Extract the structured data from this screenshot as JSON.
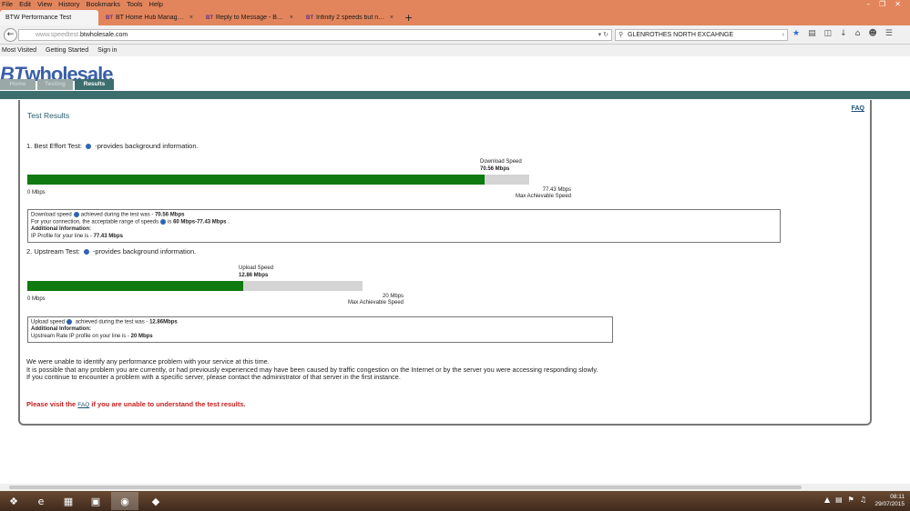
{
  "menu": [
    "File",
    "Edit",
    "View",
    "History",
    "Bookmarks",
    "Tools",
    "Help"
  ],
  "window_controls": [
    "–",
    "❐",
    "✕"
  ],
  "tabs": [
    {
      "label": "BTW Performance Test",
      "active": true
    },
    {
      "label": "BT Home Hub Manager - I...",
      "active": false
    },
    {
      "label": "Reply to Message - BTCare...",
      "active": false
    },
    {
      "label": "Infinity 2 speeds but not d...",
      "active": false
    }
  ],
  "tab_icon_text": "BT",
  "tab_close": "×",
  "new_tab": "+",
  "address": {
    "prefix": "www.speedtest.",
    "domain": "btwholesale.com"
  },
  "search": {
    "value": "GLENROTHES NORTH EXCAHNGE"
  },
  "bookmarks": [
    "Most Visited",
    "Getting Started",
    "Sign in"
  ],
  "site": {
    "logo_bt": "BT",
    "logo_rest": "wholesale",
    "nav_tabs": [
      "Home",
      "Testing",
      "Results"
    ],
    "active_tab": "Results"
  },
  "results": {
    "title": "Test Results",
    "faq": "FAQ",
    "download": {
      "heading": "1. Best Effort Test:",
      "heading_suffix": "-provides background information.",
      "speed_title": "Download Speed",
      "speed_value": "70.56 Mbps",
      "min_label": "0 Mbps",
      "max_value": "77.43 Mbps",
      "max_label": "Max Achievable Speed",
      "fill_fraction": 0.911,
      "info": {
        "line1_pre": "Download speed",
        "line1_post": "achieved during the test was - ",
        "line1_value": "70.56 Mbps",
        "line2_pre": "For your connection, the acceptable range of speeds",
        "line2_mid": "is ",
        "line2_value": "60 Mbps-77.43 Mbps",
        "line2_end": " .",
        "line3": "Additional Information:",
        "line4_pre": "IP Profile for your line is - ",
        "line4_value": "77.43 Mbps"
      }
    },
    "upload": {
      "heading": "2. Upstream Test:",
      "heading_suffix": "-provides background information.",
      "speed_title": "Upload Speed",
      "speed_value": "12.86 Mbps",
      "min_label": "0 Mbps",
      "max_value": "20 Mbps",
      "max_label": "Max Achievable Speed",
      "fill_fraction": 0.643,
      "info": {
        "line1_pre": "Upload speed",
        "line1_post": " achieved during the test was - ",
        "line1_value": "12.86Mbps",
        "line2": "Additional Information:",
        "line3_pre": "Upstream Rate IP profile on your line is - ",
        "line3_value": "20 Mbps"
      }
    },
    "summary": [
      "We were unable to identify any performance problem with your service at this time.",
      "It is possible that any problem you are currently, or had previously experienced may have been caused by traffic congestion on the Internet or by the server you were accessing responding slowly.",
      "If you continue to encounter a problem with a specific server, please contact the administrator of that server in the first instance."
    ],
    "visit_pre": "Please visit the ",
    "visit_link": "FAQ",
    "visit_post": " if you are unable to understand the test results."
  },
  "taskbar": {
    "time": "08:11",
    "date": "29/07/2015"
  }
}
